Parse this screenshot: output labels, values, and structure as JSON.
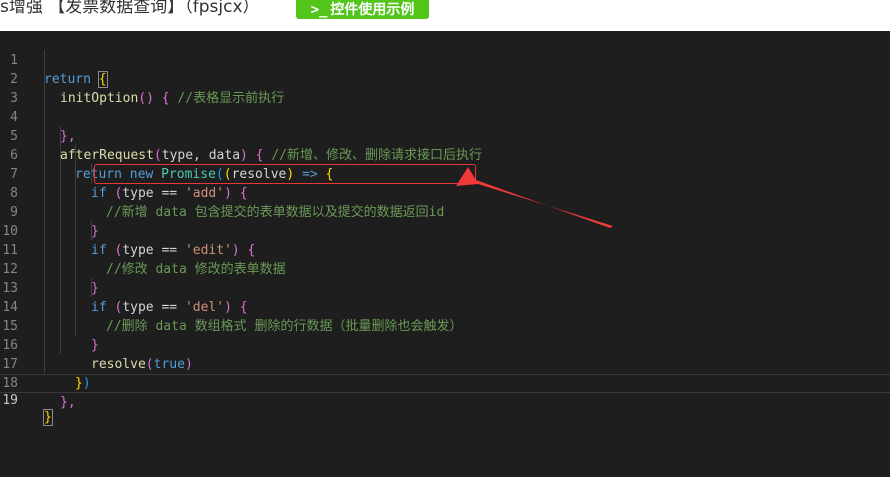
{
  "header": {
    "title": "s增强 【发票数据查询】（fpsjcx）",
    "example_button": {
      "icon": ">_",
      "label": "控件使用示例"
    }
  },
  "editor": {
    "active_line": 19,
    "line_numbers": [
      "1",
      "2",
      "3",
      "4",
      "5",
      "6",
      "7",
      "8",
      "9",
      "10",
      "11",
      "12",
      "13",
      "14",
      "15",
      "16",
      "17",
      "18",
      "19"
    ],
    "tokens": {
      "l1_return": "return",
      "l1_brace": "{",
      "l2_fn": "initOption",
      "l2_args": "()",
      "l2_brace": " {",
      "l2_comment": " //表格显示前执行",
      "l4_close": "},",
      "l5_fn": "afterRequest",
      "l5_paren_open": "(",
      "l5_params": "type, data",
      "l5_paren_close": ")",
      "l5_brace": " {",
      "l5_comment": " //新增、修改、删除请求接口后执行",
      "l6_return": "return",
      "l6_new": " new ",
      "l6_class": "Promise",
      "l6_paren_open": "(",
      "l6_inner_open": "(",
      "l6_param": "resolve",
      "l6_inner_close": ")",
      "l6_arrow": " =>",
      "l6_brace": " {",
      "l7_if": "if",
      "l7_paren_open": " (",
      "l7_cond": "type == ",
      "l7_str": "'add'",
      "l7_paren_close": ")",
      "l7_brace": " {",
      "l8_comment": "//新增 data 包含提交的表单数据以及提交的数据返回id",
      "l9_close": "}",
      "l10_if": "if",
      "l10_paren_open": " (",
      "l10_cond": "type == ",
      "l10_str": "'edit'",
      "l10_paren_close": ")",
      "l10_brace": " {",
      "l11_comment": "//修改 data 修改的表单数据",
      "l12_close": "}",
      "l13_if": "if",
      "l13_paren_open": " (",
      "l13_cond": "type == ",
      "l13_str": "'del'",
      "l13_paren_close": ")",
      "l13_brace": " {",
      "l14_comment": "//删除 data 数组格式 删除的行数据（批量删除也会触发）",
      "l15_close": "}",
      "l16_fn": "resolve",
      "l16_paren_open": "(",
      "l16_value": "true",
      "l16_paren_close": ")",
      "l17_brace": "}",
      "l17_paren": ")",
      "l18_close": "},",
      "l19_close": "}"
    }
  },
  "annotation": {
    "color": "#e83535",
    "target_line": 8
  },
  "colors": {
    "editor_bg": "#1e1e1e",
    "keyword": "#569cd6",
    "function": "#dcdcaa",
    "class": "#4ec9b0",
    "string": "#ce9178",
    "comment": "#6a9955",
    "button_bg": "#52c41a"
  }
}
